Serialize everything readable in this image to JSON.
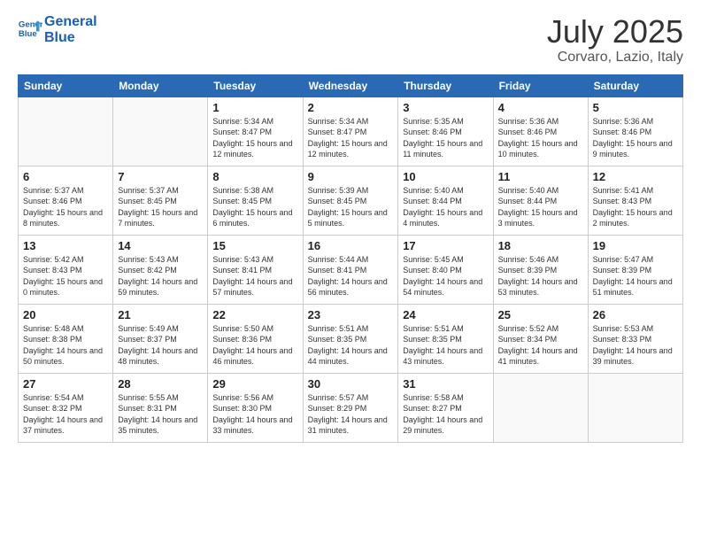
{
  "header": {
    "logo_line1": "General",
    "logo_line2": "Blue",
    "month": "July 2025",
    "location": "Corvaro, Lazio, Italy"
  },
  "weekdays": [
    "Sunday",
    "Monday",
    "Tuesday",
    "Wednesday",
    "Thursday",
    "Friday",
    "Saturday"
  ],
  "weeks": [
    [
      {
        "num": "",
        "info": ""
      },
      {
        "num": "",
        "info": ""
      },
      {
        "num": "1",
        "info": "Sunrise: 5:34 AM\nSunset: 8:47 PM\nDaylight: 15 hours and 12 minutes."
      },
      {
        "num": "2",
        "info": "Sunrise: 5:34 AM\nSunset: 8:47 PM\nDaylight: 15 hours and 12 minutes."
      },
      {
        "num": "3",
        "info": "Sunrise: 5:35 AM\nSunset: 8:46 PM\nDaylight: 15 hours and 11 minutes."
      },
      {
        "num": "4",
        "info": "Sunrise: 5:36 AM\nSunset: 8:46 PM\nDaylight: 15 hours and 10 minutes."
      },
      {
        "num": "5",
        "info": "Sunrise: 5:36 AM\nSunset: 8:46 PM\nDaylight: 15 hours and 9 minutes."
      }
    ],
    [
      {
        "num": "6",
        "info": "Sunrise: 5:37 AM\nSunset: 8:46 PM\nDaylight: 15 hours and 8 minutes."
      },
      {
        "num": "7",
        "info": "Sunrise: 5:37 AM\nSunset: 8:45 PM\nDaylight: 15 hours and 7 minutes."
      },
      {
        "num": "8",
        "info": "Sunrise: 5:38 AM\nSunset: 8:45 PM\nDaylight: 15 hours and 6 minutes."
      },
      {
        "num": "9",
        "info": "Sunrise: 5:39 AM\nSunset: 8:45 PM\nDaylight: 15 hours and 5 minutes."
      },
      {
        "num": "10",
        "info": "Sunrise: 5:40 AM\nSunset: 8:44 PM\nDaylight: 15 hours and 4 minutes."
      },
      {
        "num": "11",
        "info": "Sunrise: 5:40 AM\nSunset: 8:44 PM\nDaylight: 15 hours and 3 minutes."
      },
      {
        "num": "12",
        "info": "Sunrise: 5:41 AM\nSunset: 8:43 PM\nDaylight: 15 hours and 2 minutes."
      }
    ],
    [
      {
        "num": "13",
        "info": "Sunrise: 5:42 AM\nSunset: 8:43 PM\nDaylight: 15 hours and 0 minutes."
      },
      {
        "num": "14",
        "info": "Sunrise: 5:43 AM\nSunset: 8:42 PM\nDaylight: 14 hours and 59 minutes."
      },
      {
        "num": "15",
        "info": "Sunrise: 5:43 AM\nSunset: 8:41 PM\nDaylight: 14 hours and 57 minutes."
      },
      {
        "num": "16",
        "info": "Sunrise: 5:44 AM\nSunset: 8:41 PM\nDaylight: 14 hours and 56 minutes."
      },
      {
        "num": "17",
        "info": "Sunrise: 5:45 AM\nSunset: 8:40 PM\nDaylight: 14 hours and 54 minutes."
      },
      {
        "num": "18",
        "info": "Sunrise: 5:46 AM\nSunset: 8:39 PM\nDaylight: 14 hours and 53 minutes."
      },
      {
        "num": "19",
        "info": "Sunrise: 5:47 AM\nSunset: 8:39 PM\nDaylight: 14 hours and 51 minutes."
      }
    ],
    [
      {
        "num": "20",
        "info": "Sunrise: 5:48 AM\nSunset: 8:38 PM\nDaylight: 14 hours and 50 minutes."
      },
      {
        "num": "21",
        "info": "Sunrise: 5:49 AM\nSunset: 8:37 PM\nDaylight: 14 hours and 48 minutes."
      },
      {
        "num": "22",
        "info": "Sunrise: 5:50 AM\nSunset: 8:36 PM\nDaylight: 14 hours and 46 minutes."
      },
      {
        "num": "23",
        "info": "Sunrise: 5:51 AM\nSunset: 8:35 PM\nDaylight: 14 hours and 44 minutes."
      },
      {
        "num": "24",
        "info": "Sunrise: 5:51 AM\nSunset: 8:35 PM\nDaylight: 14 hours and 43 minutes."
      },
      {
        "num": "25",
        "info": "Sunrise: 5:52 AM\nSunset: 8:34 PM\nDaylight: 14 hours and 41 minutes."
      },
      {
        "num": "26",
        "info": "Sunrise: 5:53 AM\nSunset: 8:33 PM\nDaylight: 14 hours and 39 minutes."
      }
    ],
    [
      {
        "num": "27",
        "info": "Sunrise: 5:54 AM\nSunset: 8:32 PM\nDaylight: 14 hours and 37 minutes."
      },
      {
        "num": "28",
        "info": "Sunrise: 5:55 AM\nSunset: 8:31 PM\nDaylight: 14 hours and 35 minutes."
      },
      {
        "num": "29",
        "info": "Sunrise: 5:56 AM\nSunset: 8:30 PM\nDaylight: 14 hours and 33 minutes."
      },
      {
        "num": "30",
        "info": "Sunrise: 5:57 AM\nSunset: 8:29 PM\nDaylight: 14 hours and 31 minutes."
      },
      {
        "num": "31",
        "info": "Sunrise: 5:58 AM\nSunset: 8:27 PM\nDaylight: 14 hours and 29 minutes."
      },
      {
        "num": "",
        "info": ""
      },
      {
        "num": "",
        "info": ""
      }
    ]
  ]
}
